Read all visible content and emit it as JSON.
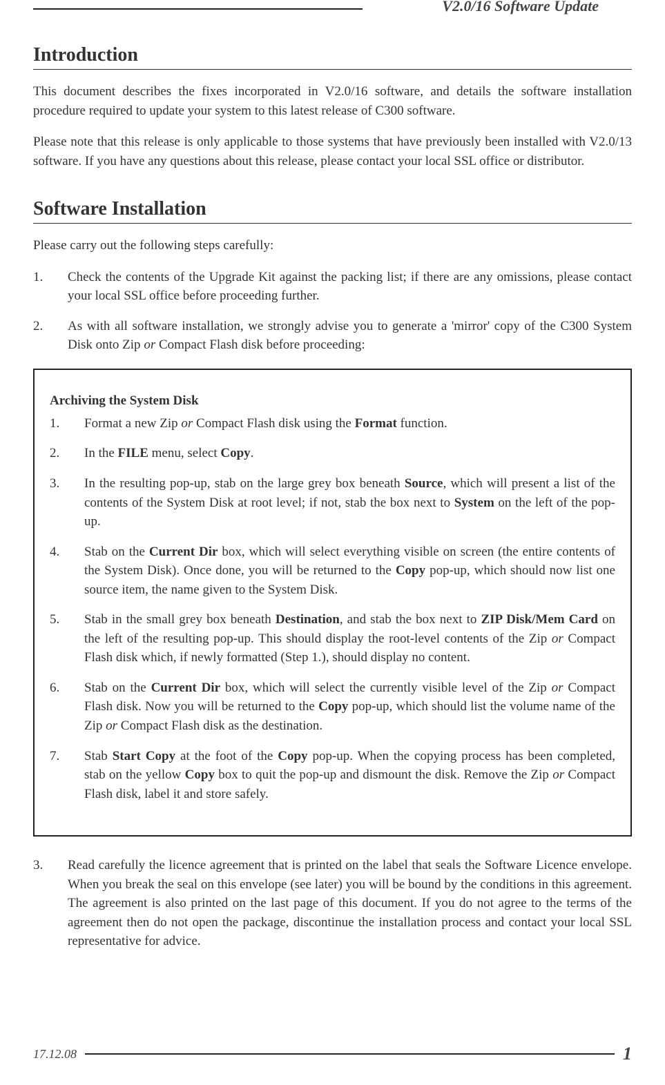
{
  "header": {
    "running_title": "V2.0/16 Software Update"
  },
  "sections": {
    "intro": {
      "heading": "Introduction",
      "p1": "This document describes the fixes incorporated in V2.0/16 software, and details the software installation procedure required to update your system to this latest release of C300 software.",
      "p2": "Please note that this release is only applicable to those systems that have previously been installed with V2.0/13 software. If you have any questions about this release, please contact your local SSL office or distributor."
    },
    "install": {
      "heading": "Software Installation",
      "lead": "Please carry out the following steps carefully:",
      "steps": [
        {
          "n": "1.",
          "html": "Check the contents of the Upgrade Kit against the packing list; if there are any omissions, please contact your local SSL office before proceeding further."
        },
        {
          "n": "2.",
          "html": "As with all software installation, we strongly advise you to generate a 'mirror' copy of the C300 System Disk onto Zip <i>or</i> Compact Flash disk before proceeding:"
        }
      ],
      "box": {
        "title": "Archiving the System Disk",
        "items": [
          {
            "n": "1.",
            "html": "Format a new Zip <i>or</i> Compact Flash disk using the <b>Format</b> function."
          },
          {
            "n": "2.",
            "html": "In the <b>FILE</b> menu, select <b>Copy</b>."
          },
          {
            "n": "3.",
            "html": "In the resulting pop-up, stab on the large grey box beneath <b>Source</b>, which will present a list of the contents of the System Disk at root level; if not, stab the box next to <b>System</b> on the left of the pop-up."
          },
          {
            "n": "4.",
            "html": "Stab on the <b>Current Dir</b> box, which will select everything visible on screen (the entire contents of the System Disk). Once done, you will be returned to the <b>Copy</b> pop-up, which should now list one source item, the name given to the System Disk."
          },
          {
            "n": "5.",
            "html": "Stab in the small grey box beneath <b>Destination</b>, and stab the box next to <b>ZIP Disk/Mem Card</b> on the left of the resulting pop-up. This should display the root-level contents of the Zip <i>or</i> Compact Flash disk which, if newly formatted (Step 1.), should display no content."
          },
          {
            "n": "6.",
            "html": "Stab on the <b>Current Dir</b> box, which will select the currently visible level of the Zip <i>or</i> Compact Flash disk. Now you will be returned to the <b>Copy</b> pop-up, which should list the volume name of the Zip <i>or</i> Compact Flash disk as the destination."
          },
          {
            "n": "7.",
            "html": "Stab <b>Start Copy</b> at the foot of the <b>Copy</b> pop-up. When the copying process has been completed, stab on the yellow <b>Copy</b> box to quit the pop-up and dismount the disk. Remove the Zip <i>or</i> Compact Flash disk, label it and store safely."
          }
        ]
      },
      "steps_cont": [
        {
          "n": "3.",
          "html": "Read carefully the licence agreement that is printed on the label that seals the Software Licence envelope. When you break the seal on this envelope (see later) you will be bound by the conditions in this agreement. The agreement is also printed on the last page of this document. If you do not agree to the terms of the agreement then do not open the package, discontinue the installation process and contact your local SSL representative for advice."
        }
      ]
    }
  },
  "footer": {
    "date": "17.12.08",
    "page": "1"
  }
}
